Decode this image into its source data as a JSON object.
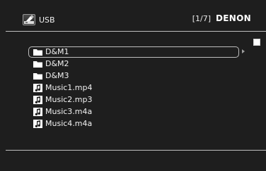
{
  "header": {
    "source_label": "USB",
    "source_icon": "usb-drive-icon",
    "page_indicator": "[1/7]",
    "brand": "DENON"
  },
  "list": {
    "items": [
      {
        "label": "D&M1",
        "type": "folder",
        "icon": "folder-icon",
        "selected": true
      },
      {
        "label": "D&M2",
        "type": "folder",
        "icon": "folder-icon",
        "selected": false
      },
      {
        "label": "D&M3",
        "type": "folder",
        "icon": "folder-icon",
        "selected": false
      },
      {
        "label": "Music1.mp4",
        "type": "audio",
        "icon": "music-note-icon",
        "selected": false
      },
      {
        "label": "Music2.mp3",
        "type": "audio",
        "icon": "music-note-icon",
        "selected": false
      },
      {
        "label": "Music3.m4a",
        "type": "audio",
        "icon": "music-note-icon",
        "selected": false
      },
      {
        "label": "Music4.m4a",
        "type": "audio",
        "icon": "music-note-icon",
        "selected": false
      }
    ]
  },
  "colors": {
    "background": "#1e1e1e",
    "text": "#f2f2f2",
    "divider": "#bfbfbf"
  }
}
